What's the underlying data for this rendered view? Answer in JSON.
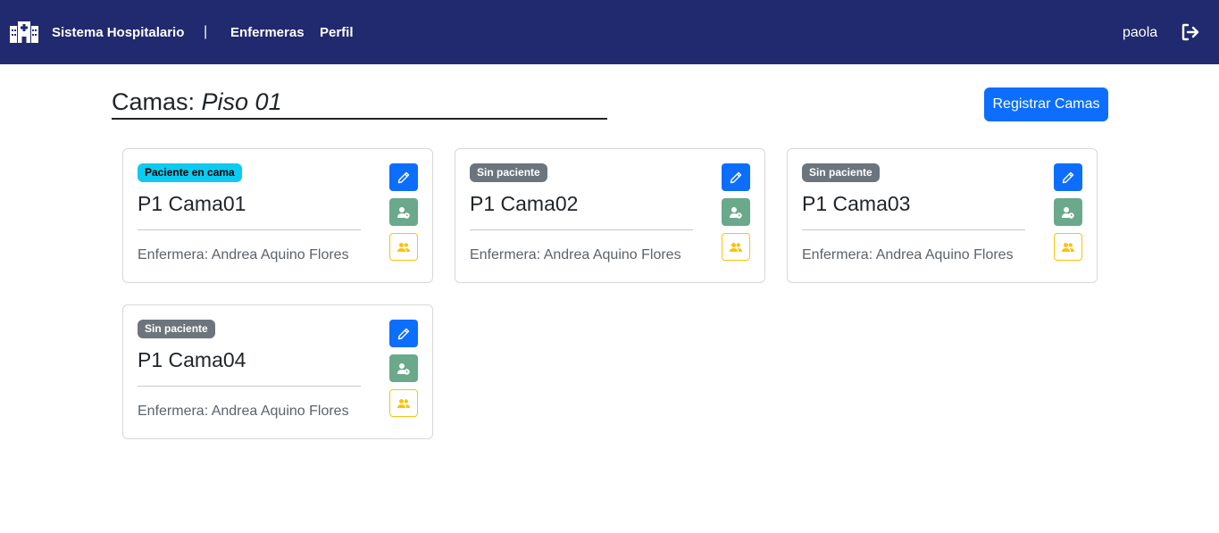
{
  "navbar": {
    "brand": "Sistema Hospitalario",
    "separator": "|",
    "links": [
      {
        "label": "Enfermeras"
      },
      {
        "label": "Perfil"
      }
    ],
    "user": "paola",
    "brand_icon": "hospital-icon",
    "logout_icon": "logout-icon"
  },
  "page": {
    "title_prefix": "Camas: ",
    "title_floor": "Piso 01",
    "register_button": "Registrar Camas"
  },
  "colors": {
    "navbar": "#212a6e",
    "primary": "#0d6efd",
    "badge_occupied": "#0dcaf0",
    "badge_empty": "#6c757d",
    "patient_button": "#6aa98b",
    "people_button_border": "#ffc107"
  },
  "beds": [
    {
      "status": "Paciente en cama",
      "status_type": "info",
      "name": "P1 Cama01",
      "nurse": "Enfermera: Andrea Aquino Flores"
    },
    {
      "status": "Sin paciente",
      "status_type": "secondary",
      "name": "P1 Cama02",
      "nurse": "Enfermera: Andrea Aquino Flores"
    },
    {
      "status": "Sin paciente",
      "status_type": "secondary",
      "name": "P1 Cama03",
      "nurse": "Enfermera: Andrea Aquino Flores"
    },
    {
      "status": "Sin paciente",
      "status_type": "secondary",
      "name": "P1 Cama04",
      "nurse": "Enfermera: Andrea Aquino Flores"
    }
  ],
  "card_actions": {
    "edit_icon": "pencil-icon",
    "patient_icon": "user-clock-icon",
    "people_icon": "users-icon"
  }
}
